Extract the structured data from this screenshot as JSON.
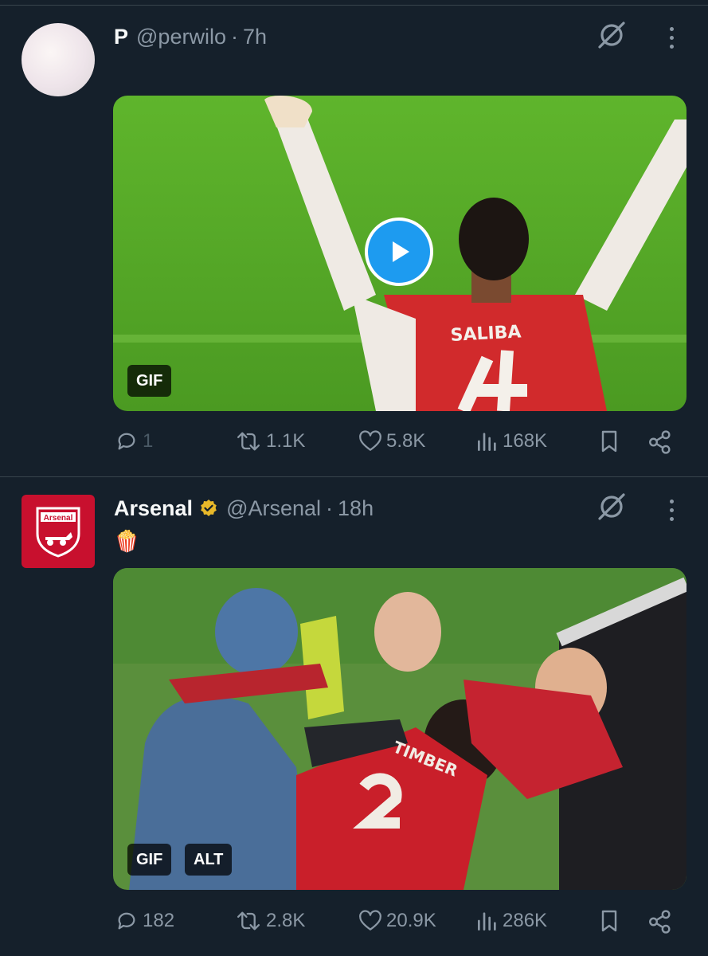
{
  "tweets": [
    {
      "name": "P",
      "handle": "@perwilo",
      "separator": "·",
      "time": "7h",
      "text": "",
      "media": {
        "badges": [
          "GIF"
        ],
        "has_play_button": true,
        "jersey_text": "SALIBA"
      },
      "actions": {
        "replies": "1",
        "retweets": "1.1K",
        "likes": "5.8K",
        "views": "168K"
      }
    },
    {
      "name": "Arsenal",
      "handle": "@Arsenal",
      "separator": "·",
      "time": "18h",
      "text": "🍿",
      "verified": true,
      "avatar_text": "Arsenal",
      "media": {
        "badges": [
          "GIF",
          "ALT"
        ],
        "jersey_text": "TIMBER"
      },
      "actions": {
        "replies": "182",
        "retweets": "2.8K",
        "likes": "20.9K",
        "views": "286K"
      }
    }
  ],
  "colors": {
    "background": "#15202b",
    "muted": "#8b98a5",
    "accent": "#1d9bf0",
    "verified_gold": "#e8b829",
    "arsenal_red": "#c8102e"
  },
  "icons": [
    "grok-icon",
    "more-icon",
    "reply-icon",
    "retweet-icon",
    "like-icon",
    "views-icon",
    "bookmark-icon",
    "share-icon",
    "play-icon",
    "verified-icon"
  ]
}
